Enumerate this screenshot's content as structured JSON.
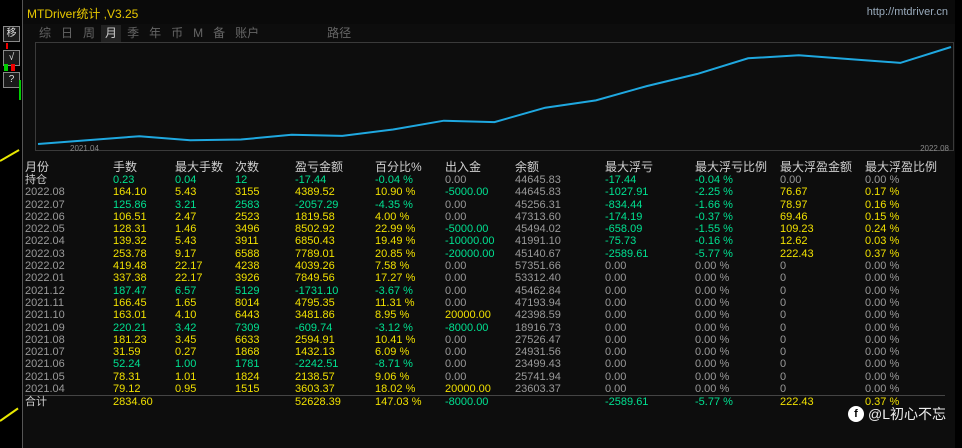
{
  "app": {
    "title": "MTDriver统计 ,V3.25",
    "site": "http://mtdriver.cn"
  },
  "tabs": [
    "综",
    "日",
    "周",
    "月",
    "季",
    "年",
    "币",
    "M",
    "备",
    "账户",
    "路径"
  ],
  "active_tab": "月",
  "left_toolbar": [
    "移",
    "√",
    "?"
  ],
  "chart_data": {
    "type": "line",
    "x_start_label": "2021.04",
    "x_end_label": "2022.08",
    "color": "#1fa8e0",
    "x": [
      "2021.04",
      "2021.05",
      "2021.06",
      "2021.07",
      "2021.08",
      "2021.09",
      "2021.10",
      "2021.11",
      "2021.12",
      "2022.01",
      "2022.02",
      "2022.03",
      "2022.04",
      "2022.05",
      "2022.06",
      "2022.07",
      "2022.08"
    ],
    "y": [
      3603.37,
      5741.94,
      7880.51,
      5638.0,
      6070.0,
      8665.0,
      8055.0,
      11536.0,
      16331.0,
      15600.0,
      23450.0,
      27489.0,
      35300.0,
      42000.0,
      50490.0,
      52200.0,
      50100.0,
      48000.0,
      56700.0
    ]
  },
  "table": {
    "headers": [
      "月份",
      "手数",
      "最大手数",
      "次数",
      "盈亏金额",
      "百分比%",
      "出入金",
      "余额",
      "最大浮亏",
      "最大浮亏比例",
      "最大浮盈金额",
      "最大浮盈比例"
    ],
    "holding": {
      "label": "持仓",
      "lots": "0.23",
      "max_lots": "0.04",
      "count": "12",
      "pl": "-17.44",
      "pct": "-0.04 %",
      "io": "0.00",
      "balance": "44645.83",
      "max_dd": "-17.44",
      "max_dd_pct": "-0.04 %",
      "max_fp": "0.00",
      "max_fp_pct": "0.00 %"
    },
    "rows": [
      {
        "m": "2022.08",
        "lots": "164.10",
        "max_lots": "5.43",
        "count": "3155",
        "pl": "4389.52",
        "pct": "10.90 %",
        "io": "-5000.00",
        "balance": "44645.83",
        "max_dd": "-1027.91",
        "max_dd_pct": "-2.25 %",
        "max_fp": "76.67",
        "max_fp_pct": "0.17 %",
        "neg": false
      },
      {
        "m": "2022.07",
        "lots": "125.86",
        "max_lots": "3.21",
        "count": "2583",
        "pl": "-2057.29",
        "pct": "-4.35 %",
        "io": "0.00",
        "balance": "45256.31",
        "max_dd": "-834.44",
        "max_dd_pct": "-1.66 %",
        "max_fp": "78.97",
        "max_fp_pct": "0.16 %",
        "neg": true
      },
      {
        "m": "2022.06",
        "lots": "106.51",
        "max_lots": "2.47",
        "count": "2523",
        "pl": "1819.58",
        "pct": "4.00 %",
        "io": "0.00",
        "balance": "47313.60",
        "max_dd": "-174.19",
        "max_dd_pct": "-0.37 %",
        "max_fp": "69.46",
        "max_fp_pct": "0.15 %",
        "neg": false
      },
      {
        "m": "2022.05",
        "lots": "128.31",
        "max_lots": "1.46",
        "count": "3496",
        "pl": "8502.92",
        "pct": "22.99 %",
        "io": "-5000.00",
        "balance": "45494.02",
        "max_dd": "-658.09",
        "max_dd_pct": "-1.55 %",
        "max_fp": "109.23",
        "max_fp_pct": "0.24 %",
        "neg": false
      },
      {
        "m": "2022.04",
        "lots": "139.32",
        "max_lots": "5.43",
        "count": "3911",
        "pl": "6850.43",
        "pct": "19.49 %",
        "io": "-10000.00",
        "balance": "41991.10",
        "max_dd": "-75.73",
        "max_dd_pct": "-0.16 %",
        "max_fp": "12.62",
        "max_fp_pct": "0.03 %",
        "neg": false
      },
      {
        "m": "2022.03",
        "lots": "253.78",
        "max_lots": "9.17",
        "count": "6588",
        "pl": "7789.01",
        "pct": "20.85 %",
        "io": "-20000.00",
        "balance": "45140.67",
        "max_dd": "-2589.61",
        "max_dd_pct": "-5.77 %",
        "max_fp": "222.43",
        "max_fp_pct": "0.37 %",
        "neg": false
      },
      {
        "m": "2022.02",
        "lots": "419.48",
        "max_lots": "22.17",
        "count": "4238",
        "pl": "4039.26",
        "pct": "7.58 %",
        "io": "0.00",
        "balance": "57351.66",
        "max_dd": "0.00",
        "max_dd_pct": "0.00 %",
        "max_fp": "0",
        "max_fp_pct": "0.00 %",
        "neg": false
      },
      {
        "m": "2022.01",
        "lots": "337.38",
        "max_lots": "22.17",
        "count": "3926",
        "pl": "7849.56",
        "pct": "17.27 %",
        "io": "0.00",
        "balance": "53312.40",
        "max_dd": "0.00",
        "max_dd_pct": "0.00 %",
        "max_fp": "0",
        "max_fp_pct": "0.00 %",
        "neg": false
      },
      {
        "m": "2021.12",
        "lots": "187.47",
        "max_lots": "6.57",
        "count": "5129",
        "pl": "-1731.10",
        "pct": "-3.67 %",
        "io": "0.00",
        "balance": "45462.84",
        "max_dd": "0.00",
        "max_dd_pct": "0.00 %",
        "max_fp": "0",
        "max_fp_pct": "0.00 %",
        "neg": true
      },
      {
        "m": "2021.11",
        "lots": "166.45",
        "max_lots": "1.65",
        "count": "8014",
        "pl": "4795.35",
        "pct": "11.31 %",
        "io": "0.00",
        "balance": "47193.94",
        "max_dd": "0.00",
        "max_dd_pct": "0.00 %",
        "max_fp": "0",
        "max_fp_pct": "0.00 %",
        "neg": false
      },
      {
        "m": "2021.10",
        "lots": "163.01",
        "max_lots": "4.10",
        "count": "6443",
        "pl": "3481.86",
        "pct": "8.95 %",
        "io": "20000.00",
        "balance": "42398.59",
        "max_dd": "0.00",
        "max_dd_pct": "0.00 %",
        "max_fp": "0",
        "max_fp_pct": "0.00 %",
        "neg": false
      },
      {
        "m": "2021.09",
        "lots": "220.21",
        "max_lots": "3.42",
        "count": "7309",
        "pl": "-609.74",
        "pct": "-3.12 %",
        "io": "-8000.00",
        "balance": "18916.73",
        "max_dd": "0.00",
        "max_dd_pct": "0.00 %",
        "max_fp": "0",
        "max_fp_pct": "0.00 %",
        "neg": true
      },
      {
        "m": "2021.08",
        "lots": "181.23",
        "max_lots": "3.45",
        "count": "6633",
        "pl": "2594.91",
        "pct": "10.41 %",
        "io": "0.00",
        "balance": "27526.47",
        "max_dd": "0.00",
        "max_dd_pct": "0.00 %",
        "max_fp": "0",
        "max_fp_pct": "0.00 %",
        "neg": false
      },
      {
        "m": "2021.07",
        "lots": "31.59",
        "max_lots": "0.27",
        "count": "1868",
        "pl": "1432.13",
        "pct": "6.09 %",
        "io": "0.00",
        "balance": "24931.56",
        "max_dd": "0.00",
        "max_dd_pct": "0.00 %",
        "max_fp": "0",
        "max_fp_pct": "0.00 %",
        "neg": false
      },
      {
        "m": "2021.06",
        "lots": "52.24",
        "max_lots": "1.00",
        "count": "1781",
        "pl": "-2242.51",
        "pct": "-8.71 %",
        "io": "0.00",
        "balance": "23499.43",
        "max_dd": "0.00",
        "max_dd_pct": "0.00 %",
        "max_fp": "0",
        "max_fp_pct": "0.00 %",
        "neg": true
      },
      {
        "m": "2021.05",
        "lots": "78.31",
        "max_lots": "1.01",
        "count": "1824",
        "pl": "2138.57",
        "pct": "9.06 %",
        "io": "0.00",
        "balance": "25741.94",
        "max_dd": "0.00",
        "max_dd_pct": "0.00 %",
        "max_fp": "0",
        "max_fp_pct": "0.00 %",
        "neg": false
      },
      {
        "m": "2021.04",
        "lots": "79.12",
        "max_lots": "0.95",
        "count": "1515",
        "pl": "3603.37",
        "pct": "18.02 %",
        "io": "20000.00",
        "balance": "23603.37",
        "max_dd": "0.00",
        "max_dd_pct": "0.00 %",
        "max_fp": "0",
        "max_fp_pct": "0.00 %",
        "neg": false
      }
    ],
    "total": {
      "label": "合计",
      "lots": "2834.60",
      "pl": "52628.39",
      "pct": "147.03 %",
      "io": "-8000.00",
      "max_dd": "-2589.61",
      "max_dd_pct": "-5.77 %",
      "max_fp": "222.43",
      "max_fp_pct": "0.37 %"
    }
  },
  "watermark": "@L初心不忘"
}
